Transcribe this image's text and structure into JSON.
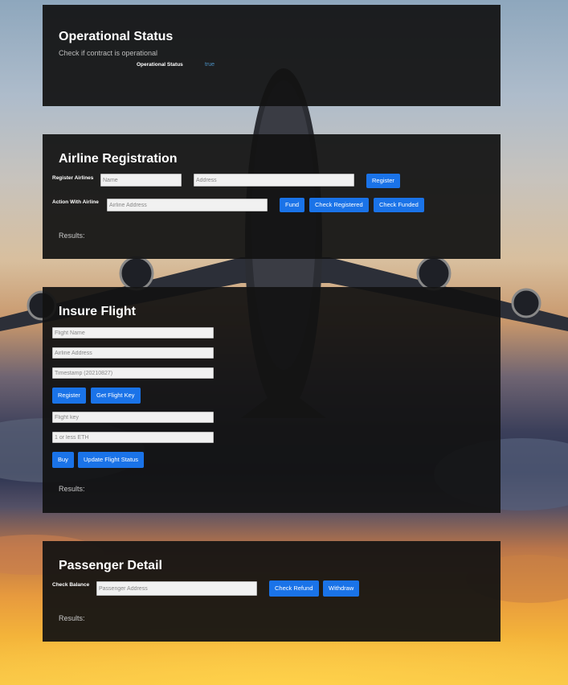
{
  "operational": {
    "title": "Operational Status",
    "subtitle": "Check if contract is operational",
    "status_label": "Operational Status",
    "status_value": "true"
  },
  "airline": {
    "title": "Airline Registration",
    "register_label": "Register Airlines",
    "name_placeholder": "Name",
    "address_placeholder": "Address",
    "register_button": "Register",
    "action_label": "Action With Airline",
    "airline_address_placeholder": "Airline Address",
    "fund_button": "Fund",
    "check_registered_button": "Check Registered",
    "check_funded_button": "Check Funded",
    "results_label": "Results:"
  },
  "insure": {
    "title": "Insure Flight",
    "flight_name_placeholder": "Flight Name",
    "airline_address_placeholder": "Airline Address",
    "timestamp_placeholder": "Timestamp (20210827)",
    "register_button": "Register",
    "get_flight_key_button": "Get Flight Key",
    "flight_key_placeholder": "Flight key",
    "eth_placeholder": "1 or less ETH",
    "buy_button": "Buy",
    "update_status_button": "Update Flight Status",
    "results_label": "Results:"
  },
  "passenger": {
    "title": "Passenger Detail",
    "check_balance_label": "Check Balance",
    "passenger_address_placeholder": "Passenger Address",
    "check_refund_button": "Check Refund",
    "withdraw_button": "Withdraw",
    "results_label": "Results:"
  },
  "colors": {
    "panel": "#121212",
    "button": "#1a73e8",
    "status_value": "#4a90c2"
  }
}
